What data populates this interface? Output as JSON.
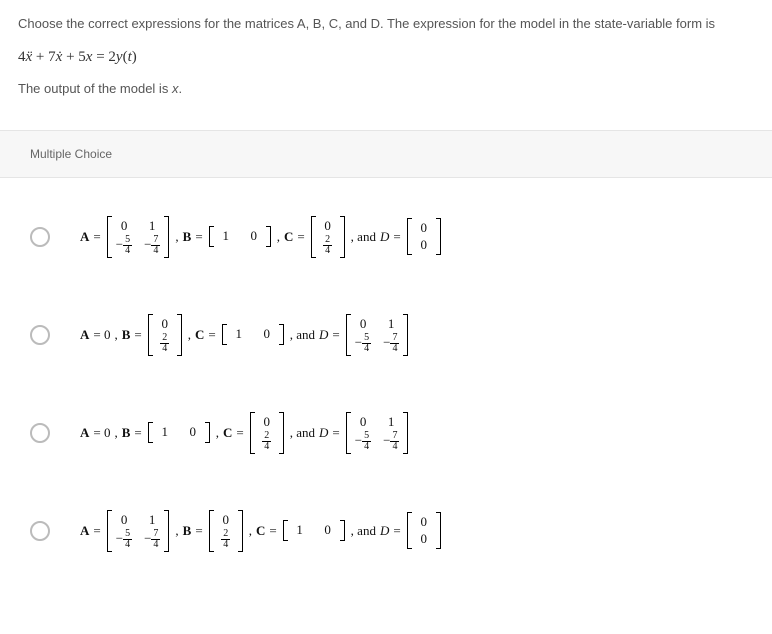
{
  "question": {
    "prompt": "Choose the correct expressions for the matrices A, B, C, and D. The expression for the model in the state-variable form is",
    "equation_html": "4<span class=\"var\">x&#776;</span> + 7<span class=\"var\">x&#775;</span> + 5<span class=\"var\">x</span> = 2<span class=\"var\">y</span>(<span class=\"var\">t</span>)",
    "output_line_html": "The output of the model is <em>x</em>."
  },
  "section_label": "Multiple Choice",
  "matrices": {
    "A2x2": [
      [
        "0",
        "1"
      ],
      [
        "−<span class=\"frac\"><span class=\"num\">5</span><span class=\"den\">4</span></span>",
        "−<span class=\"frac\"><span class=\"num\">7</span><span class=\"den\">4</span></span>"
      ]
    ],
    "row10": [
      [
        "1",
        "0"
      ]
    ],
    "col024": [
      [
        "0"
      ],
      [
        "<span class=\"frac\"><span class=\"num\">2</span><span class=\"den\">4</span></span>"
      ]
    ],
    "col00": [
      [
        "0"
      ],
      [
        "0"
      ]
    ]
  },
  "choices": [
    {
      "id": "opt-a",
      "parts": [
        "A_eq_A2x2",
        "comma",
        "B_eq_row10",
        "comma",
        "C_eq_col024",
        "comma_and",
        "D_eq_col00"
      ]
    },
    {
      "id": "opt-b",
      "parts": [
        "A_eq_0",
        "comma",
        "B_eq_col024",
        "comma",
        "C_eq_row10",
        "comma_and",
        "D_eq_A2x2"
      ]
    },
    {
      "id": "opt-c",
      "parts": [
        "A_eq_0",
        "comma",
        "B_eq_row10",
        "comma",
        "C_eq_col024",
        "comma_and",
        "D_eq_A2x2"
      ]
    },
    {
      "id": "opt-d",
      "parts": [
        "A_eq_A2x2",
        "comma",
        "B_eq_col024",
        "comma",
        "C_eq_row10",
        "comma_and",
        "D_eq_col00"
      ]
    }
  ],
  "tokens": {
    "A": "A",
    "B": "B",
    "C": "C",
    "D": "D",
    "eq": "=",
    "zero": "0",
    "comma": ",",
    "and": "and"
  }
}
